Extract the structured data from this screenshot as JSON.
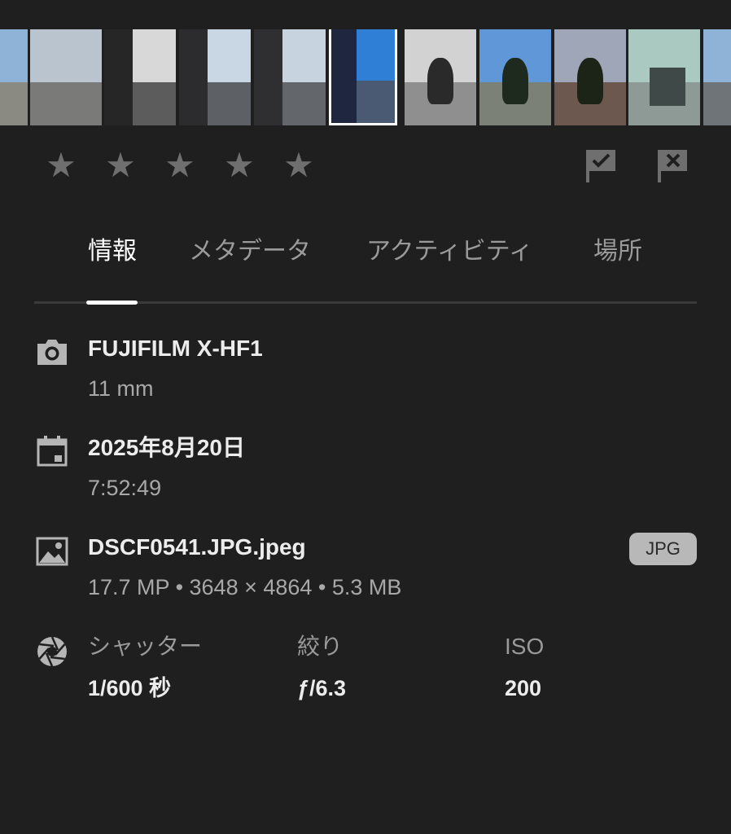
{
  "filmstrip": {
    "selected_index": 5,
    "count": 10
  },
  "rating": {
    "stars": [
      "★",
      "★",
      "★",
      "★",
      "★"
    ],
    "value": 0
  },
  "flags": {
    "pick": "flag-check-icon",
    "reject": "flag-x-icon"
  },
  "tabs": [
    {
      "label": "情報"
    },
    {
      "label": "メタデータ"
    },
    {
      "label": "アクティビティ"
    },
    {
      "label": "場所"
    }
  ],
  "info": {
    "camera": {
      "model": "FUJIFILM X-HF1",
      "focal_length": "11 mm"
    },
    "date": {
      "date": "2025年8月20日",
      "time": "7:52:49"
    },
    "file": {
      "name": "DSCF0541.JPG.jpeg",
      "details": "17.7 MP • 3648 × 4864 • 5.3 MB",
      "format_badge": "JPG"
    },
    "exposure": {
      "shutter_label": "シャッター",
      "shutter_value": "1/600",
      "shutter_unit": "秒",
      "aperture_label": "絞り",
      "aperture_value": "ƒ/6.3",
      "iso_label": "ISO",
      "iso_value": "200"
    }
  },
  "colors": {
    "background": "#1f1f1f",
    "star": "#6f6f6f",
    "badge": "#b8b8b8",
    "active_tab": "#ffffff",
    "inactive_tab": "#9a9a9a"
  }
}
